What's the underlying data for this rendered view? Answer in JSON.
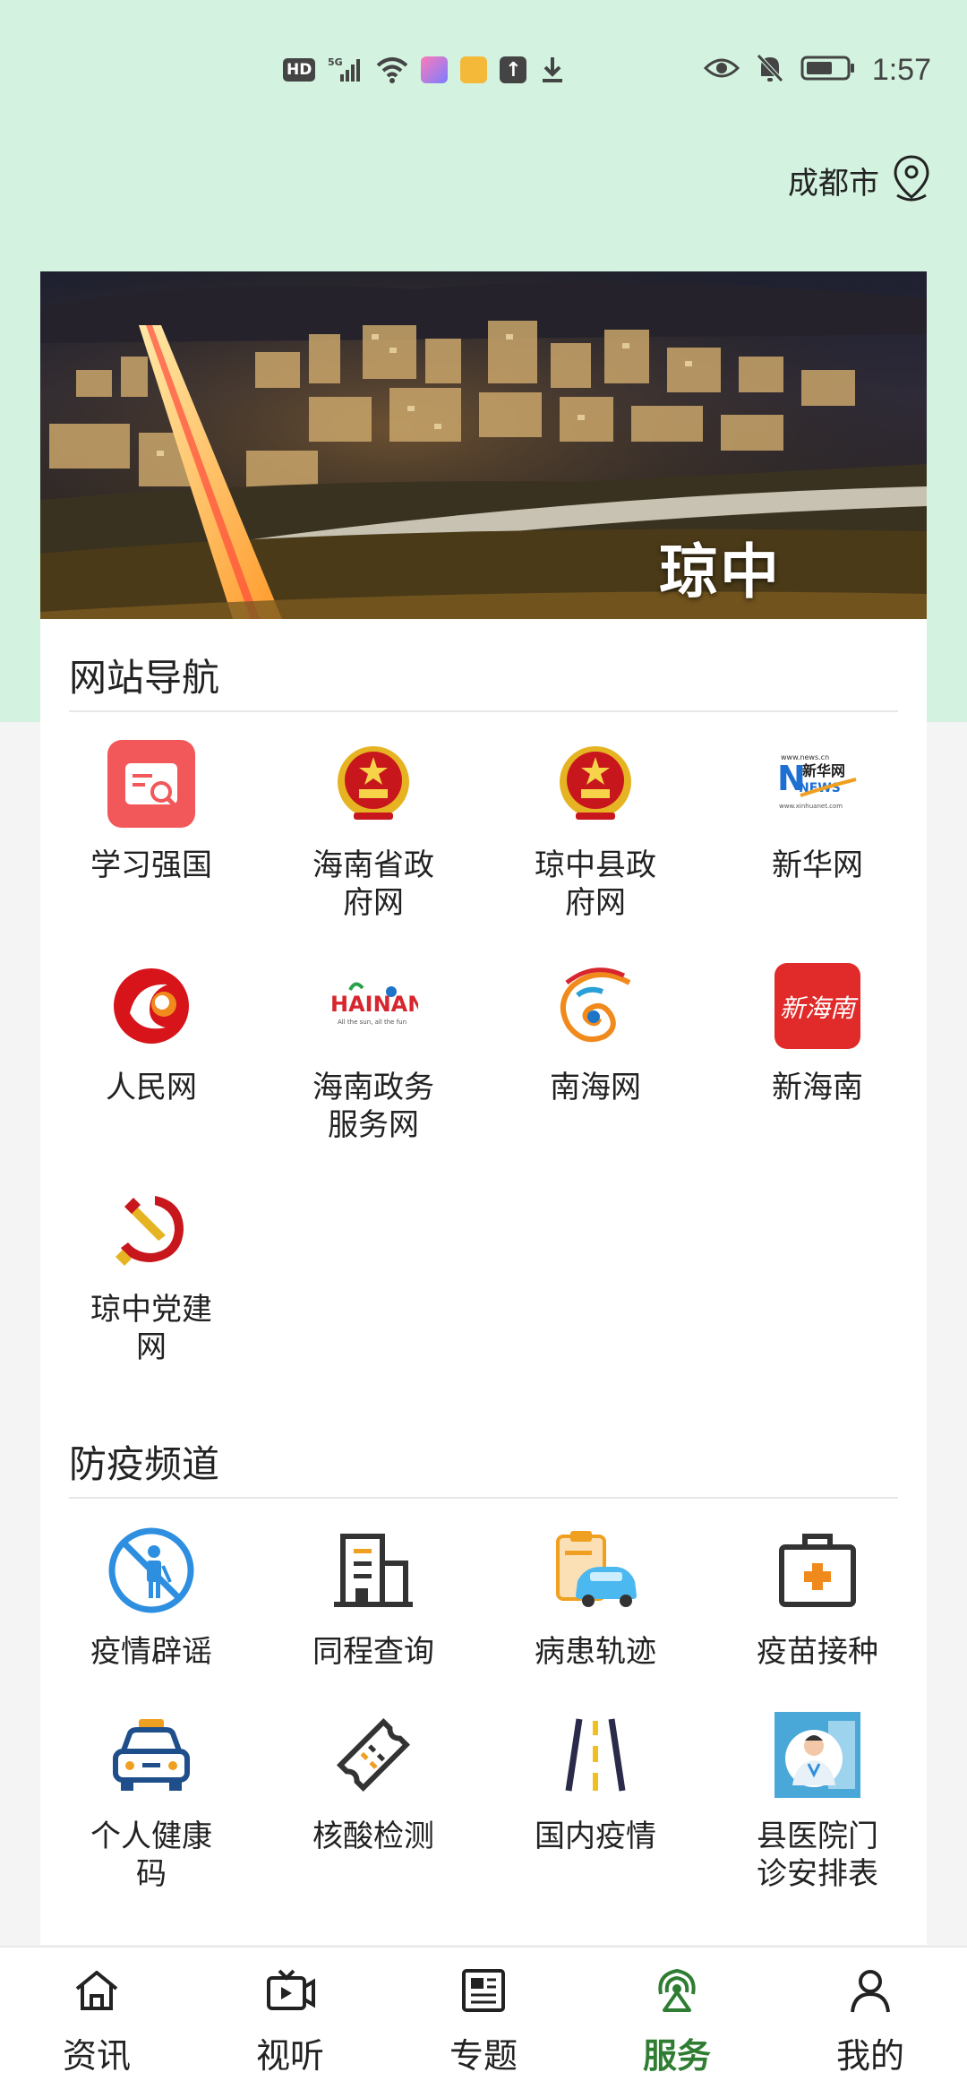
{
  "status_bar": {
    "time": "1:57",
    "hd": "HD",
    "network": "5G",
    "battery": "battery-icon"
  },
  "location": {
    "city": "成都市"
  },
  "banner": {
    "title": "琼中"
  },
  "sections": {
    "nav": {
      "title": "网站导航",
      "items": [
        {
          "label": "学习强国",
          "icon": "xuexi-qiangguo-icon"
        },
        {
          "label": "海南省政府网",
          "icon": "national-emblem-icon"
        },
        {
          "label": "琼中县政府网",
          "icon": "national-emblem-icon"
        },
        {
          "label": "新华网",
          "icon": "xinhua-news-icon"
        },
        {
          "label": "人民网",
          "icon": "people-daily-icon"
        },
        {
          "label": "海南政务服务网",
          "icon": "hainan-logo-icon"
        },
        {
          "label": "南海网",
          "icon": "nanhai-swirl-icon"
        },
        {
          "label": "新海南",
          "icon": "xin-hainan-icon"
        },
        {
          "label": "琼中党建网",
          "icon": "party-emblem-icon"
        }
      ],
      "logo_text": {
        "xinhua_top": "www.news.cn",
        "xinhua_main": "新华网",
        "xinhua_news": "NEWS",
        "xinhua_bottom": "www.xinhuanet.com",
        "hainan": "HAINAN",
        "hainan_tagline": "All the sun, all the fun",
        "xin_hainan": "新海南"
      }
    },
    "epidemic": {
      "title": "防疫频道",
      "items": [
        {
          "label": "疫情辟谣",
          "icon": "no-rumor-icon"
        },
        {
          "label": "同程查询",
          "icon": "building-icon"
        },
        {
          "label": "病患轨迹",
          "icon": "car-track-icon"
        },
        {
          "label": "疫苗接种",
          "icon": "medical-kit-icon"
        },
        {
          "label": "个人健康码",
          "icon": "taxi-icon"
        },
        {
          "label": "核酸检测",
          "icon": "ticket-icon"
        },
        {
          "label": "国内疫情",
          "icon": "road-icon"
        },
        {
          "label": "县医院门诊安排表",
          "icon": "doctor-icon"
        }
      ]
    }
  },
  "bottom_nav": [
    {
      "label": "资讯",
      "icon": "home-icon",
      "active": false
    },
    {
      "label": "视听",
      "icon": "tv-icon",
      "active": false
    },
    {
      "label": "专题",
      "icon": "newspaper-icon",
      "active": false
    },
    {
      "label": "服务",
      "icon": "service-broadcast-icon",
      "active": true
    },
    {
      "label": "我的",
      "icon": "user-icon",
      "active": false
    }
  ],
  "colors": {
    "header_bg": "#d3f3e0",
    "accent_green": "#2f7d32",
    "epidemic_blue": "#2e8fe0",
    "emblem_red": "#c8161d",
    "emblem_gold": "#e6b422"
  }
}
